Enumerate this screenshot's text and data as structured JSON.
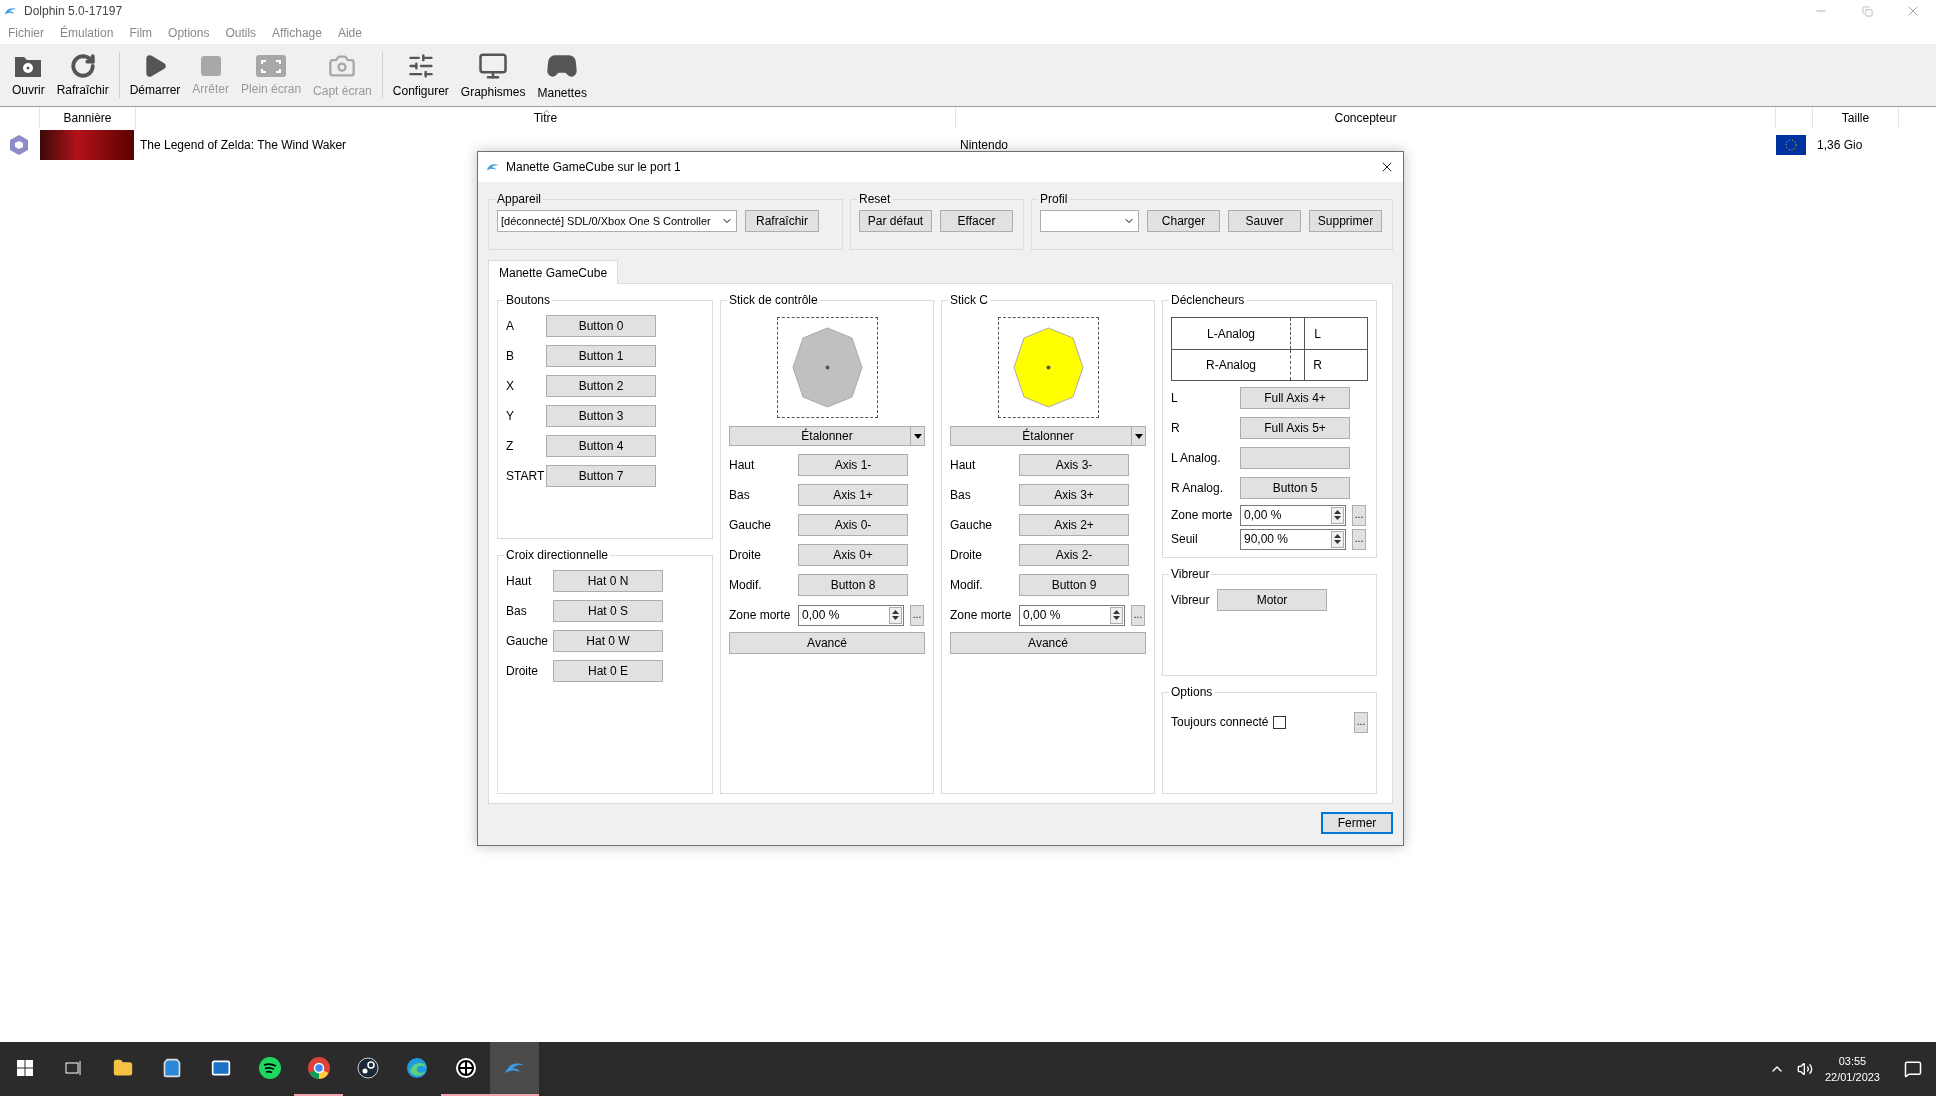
{
  "window": {
    "title": "Dolphin 5.0-17197"
  },
  "menu": [
    "Fichier",
    "Émulation",
    "Film",
    "Options",
    "Outils",
    "Affichage",
    "Aide"
  ],
  "toolbar": [
    {
      "kind": "open",
      "label": "Ouvrir",
      "disabled": false
    },
    {
      "kind": "refresh",
      "label": "Rafraîchir",
      "disabled": false
    },
    {
      "kind": "play",
      "label": "Démarrer",
      "disabled": false
    },
    {
      "kind": "stop",
      "label": "Arrêter",
      "disabled": true
    },
    {
      "kind": "fullscreen",
      "label": "Plein écran",
      "disabled": true
    },
    {
      "kind": "screenshot",
      "label": "Capt écran",
      "disabled": true
    },
    {
      "kind": "config",
      "label": "Configurer",
      "disabled": false
    },
    {
      "kind": "graphics",
      "label": "Graphismes",
      "disabled": false
    },
    {
      "kind": "controllers",
      "label": "Manettes",
      "disabled": false
    }
  ],
  "game_list": {
    "columns": [
      {
        "label": "Bannière",
        "sorted": false
      },
      {
        "label": "Titre",
        "sorted": true
      },
      {
        "label": "Concepteur",
        "sorted": false
      },
      {
        "label": "Taille",
        "sorted": false
      }
    ],
    "rows": [
      {
        "title": "The Legend of Zelda: The Wind Waker",
        "maker": "Nintendo",
        "size": "1,36 Gio"
      }
    ]
  },
  "dialog": {
    "title": "Manette GameCube sur le port 1",
    "device": {
      "label": "Appareil",
      "value": "[déconnecté] SDL/0/Xbox One S Controller",
      "button": "Rafraîchir"
    },
    "reset": {
      "label": "Reset",
      "buttons": [
        "Par défaut",
        "Effacer"
      ]
    },
    "profile": {
      "label": "Profil",
      "buttons": [
        "Charger",
        "Sauver",
        "Supprimer"
      ]
    },
    "tabs": [
      {
        "label": "Manette GameCube",
        "selected": true
      }
    ],
    "buttons_group": {
      "title": "Boutons",
      "mappings": [
        {
          "label": "A",
          "value": "Button 0"
        },
        {
          "label": "B",
          "value": "Button 1"
        },
        {
          "label": "X",
          "value": "Button 2"
        },
        {
          "label": "Y",
          "value": "Button 3"
        },
        {
          "label": "Z",
          "value": "Button 4"
        },
        {
          "label": "START",
          "value": "Button 7"
        }
      ]
    },
    "dpad": {
      "title": "Croix directionnelle",
      "mappings": [
        {
          "label": "Haut",
          "value": "Hat 0 N"
        },
        {
          "label": "Bas",
          "value": "Hat 0 S"
        },
        {
          "label": "Gauche",
          "value": "Hat 0 W"
        },
        {
          "label": "Droite",
          "value": "Hat 0 E"
        }
      ]
    },
    "sticks": [
      {
        "title": "Stick de contrôle",
        "color": "#c0c0c0",
        "calibrate": "Étalonner",
        "mappings": [
          {
            "label": "Haut",
            "value": "Axis 1-"
          },
          {
            "label": "Bas",
            "value": "Axis 1+"
          },
          {
            "label": "Gauche",
            "value": "Axis 0-"
          },
          {
            "label": "Droite",
            "value": "Axis 0+"
          },
          {
            "label": "Modif.",
            "value": "Button 8"
          }
        ],
        "dead_zone": {
          "label": "Zone morte",
          "value": "0,00 %",
          "more": "..."
        },
        "advanced": "Avancé"
      },
      {
        "title": "Stick C",
        "color": "#ffff00",
        "calibrate": "Étalonner",
        "mappings": [
          {
            "label": "Haut",
            "value": "Axis 3-"
          },
          {
            "label": "Bas",
            "value": "Axis 3+"
          },
          {
            "label": "Gauche",
            "value": "Axis 2+"
          },
          {
            "label": "Droite",
            "value": "Axis 2-"
          },
          {
            "label": "Modif.",
            "value": "Button 9"
          }
        ],
        "dead_zone": {
          "label": "Zone morte",
          "value": "0,00 %",
          "more": "..."
        },
        "advanced": "Avancé"
      }
    ],
    "triggers": {
      "title": "Déclencheurs",
      "analog_rows": [
        {
          "label": "L-Analog",
          "key": "L"
        },
        {
          "label": "R-Analog",
          "key": "R"
        }
      ],
      "mappings": [
        {
          "label": "L",
          "value": "Full Axis 4+"
        },
        {
          "label": "R",
          "value": "Full Axis 5+"
        },
        {
          "label": "L Analog."
        },
        {
          "label": "R Analog.",
          "value": "Button 5"
        }
      ],
      "spins": [
        {
          "label": "Zone morte",
          "value": "0,00 %",
          "more": "..."
        },
        {
          "label": "Seuil",
          "value": "90,00 %",
          "more": "..."
        }
      ]
    },
    "rumble": {
      "title": "Vibreur",
      "mappings": [
        {
          "label": "Vibreur",
          "value": "Motor"
        }
      ]
    },
    "options": {
      "title": "Options",
      "checkboxes": [
        {
          "label": "Toujours connecté",
          "checked": false,
          "more": "..."
        }
      ]
    },
    "close_button": "Fermer"
  },
  "taskbar": {
    "apps": [
      {
        "kind": "start",
        "running": false,
        "selected": false
      },
      {
        "kind": "taskview",
        "running": false,
        "selected": false
      },
      {
        "kind": "explorer",
        "running": false,
        "selected": false
      },
      {
        "kind": "store",
        "running": false,
        "selected": false
      },
      {
        "kind": "mail",
        "running": false,
        "selected": false
      },
      {
        "kind": "spotify",
        "running": false,
        "selected": false
      },
      {
        "kind": "chrome",
        "running": true,
        "selected": false
      },
      {
        "kind": "steam",
        "running": false,
        "selected": false
      },
      {
        "kind": "edge",
        "running": false,
        "selected": false
      },
      {
        "kind": "wheel",
        "running": true,
        "selected": false
      },
      {
        "kind": "dolphin",
        "running": true,
        "selected": true
      }
    ],
    "time": "03:55",
    "date": "22/01/2023"
  }
}
